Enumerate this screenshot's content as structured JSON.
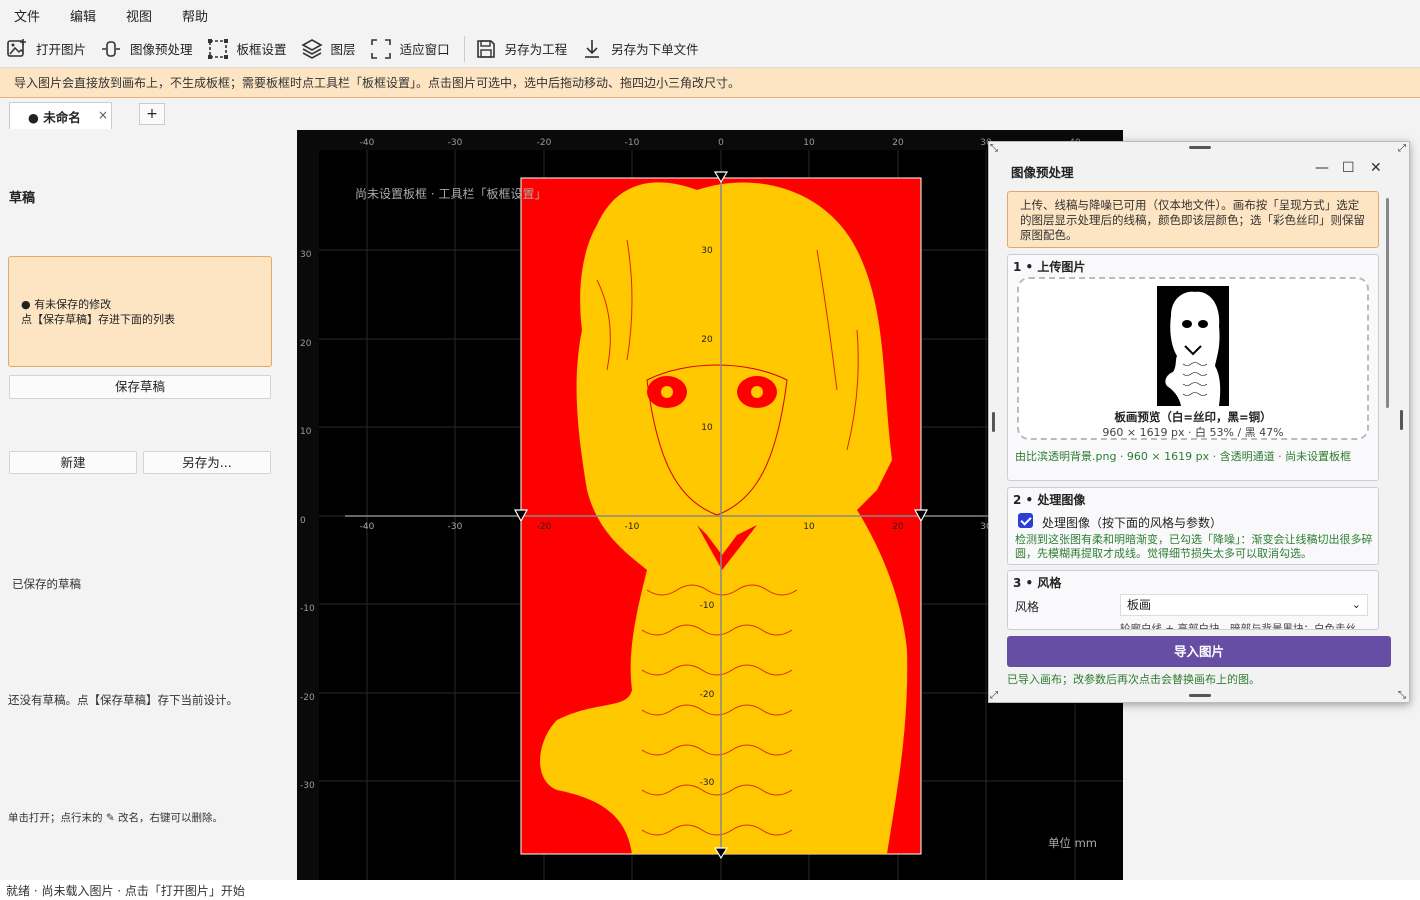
{
  "menu": [
    "文件",
    "编辑",
    "视图",
    "帮助"
  ],
  "toolbar": {
    "open_image": "打开图片",
    "preprocess": "图像预处理",
    "board_settings": "板框设置",
    "layers": "图层",
    "fit_window": "适应窗口",
    "save_project": "另存为工程",
    "save_order": "另存为下单文件"
  },
  "notice": "导入图片会直接放到画布上，不生成板框；需要板框时点工具栏「板框设置」。点击图片可选中，选中后拖动移动、拖四边小三角改尺寸。",
  "tab": {
    "label": "● 未命名",
    "close": "×",
    "add": "+"
  },
  "left": {
    "title": "草稿",
    "unsaved_line1": "● 有未保存的修改",
    "unsaved_line2": "点【保存草稿】存进下面的列表",
    "save_draft": "保存草稿",
    "new": "新建",
    "save_as": "另存为...",
    "saved_label": "已保存的草稿",
    "empty_hint": "还没有草稿。点【保存草稿】存下当前设计。",
    "usage_hint": "单击打开；点行末的 ✎ 改名，右键可以删除。"
  },
  "canvas": {
    "overlay_text": "尚未设置板框 · 工具栏「板框设置」",
    "unit": "单位 mm",
    "top_ticks": [
      "-40",
      "-30",
      "-20",
      "-10",
      "0",
      "10",
      "20",
      "30",
      "40"
    ],
    "axis_x_ticks": [
      "-40",
      "-30",
      "-20",
      "-10",
      "10",
      "20",
      "30"
    ],
    "left_ticks": [
      "30",
      "20",
      "10",
      "0",
      "-10",
      "-20",
      "-30"
    ],
    "axis_y_ticks": [
      "30",
      "20",
      "10",
      "-10",
      "-20",
      "-30"
    ],
    "bg_color": "#ff0000",
    "fg_color": "#ffc800"
  },
  "dialog": {
    "title": "图像预处理",
    "minimize": "—",
    "maximize": "☐",
    "close": "✕",
    "info": "上传、线稿与降噪已可用（仅本地文件）。画布按「呈现方式」选定的图层显示处理后的线稿，颜色即该层颜色；选「彩色丝印」则保留原图配色。",
    "s1_title": "1 • 上传图片",
    "preview_label": "板画预览（白=丝印，黑=铜）",
    "preview_info": "960 × 1619 px · 白 53% / 黑 47%",
    "file_info": "由比滨透明背景.png · 960 × 1619 px · 含透明通道 · 尚未设置板框",
    "s2_title": "2 • 处理图像",
    "process_label": "处理图像（按下面的风格与参数）",
    "process_hint": "检测到这张图有柔和明暗渐变，已勾选「降噪」：渐变会让线稿切出很多碎圆，先模糊再提取才成线。觉得细节损失太多可以取消勾选。",
    "s3_title": "3 • 风格",
    "style_label": "风格",
    "style_value": "板画",
    "style_desc": "轮廓白线 + 亮部白块，暗部与背景黑块；白色走丝",
    "import_btn": "导入图片",
    "import_hint": "已导入画布；改参数后再次点击会替换画布上的图。"
  },
  "status": "就绪 · 尚未载入图片 · 点击「打开图片」开始"
}
